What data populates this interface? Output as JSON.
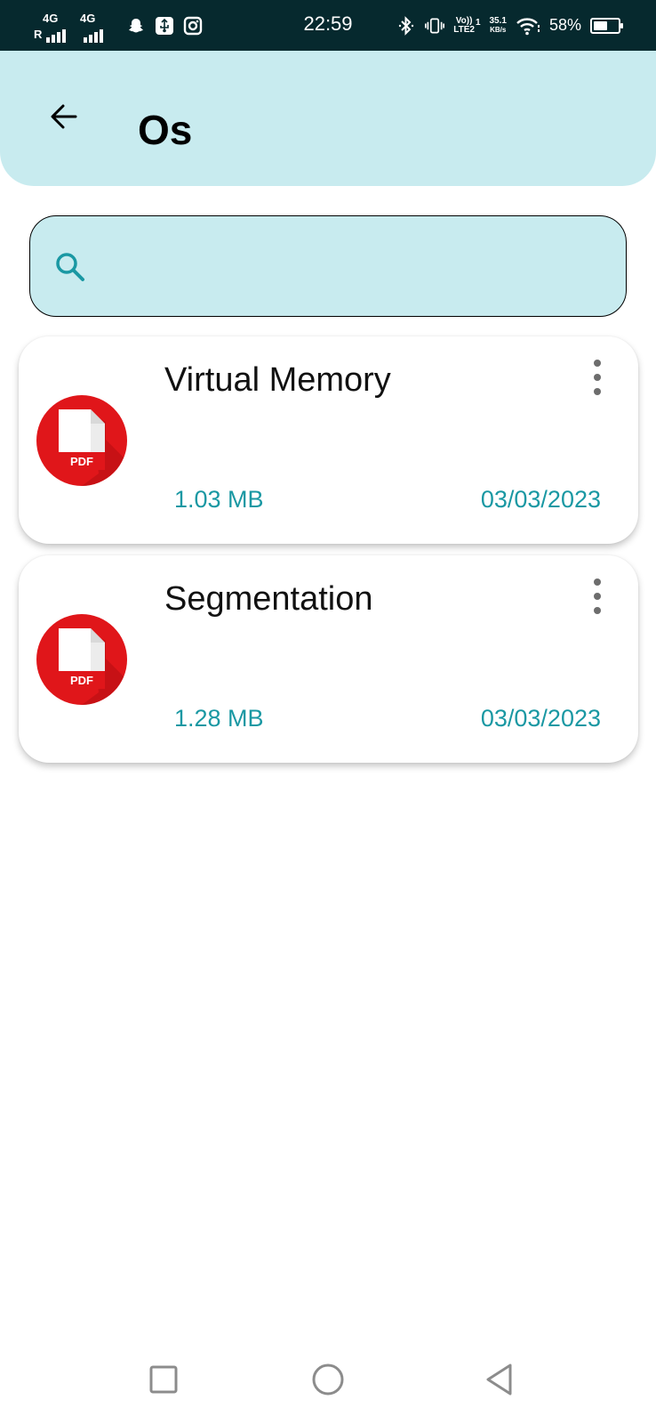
{
  "status_bar": {
    "sim1": {
      "network": "4G",
      "roaming": "R"
    },
    "sim2": {
      "network": "4G"
    },
    "time": "22:59",
    "volte": {
      "line1": "Vo))",
      "line2": "LTE2",
      "sim": "1"
    },
    "net_speed": {
      "value": "35.1",
      "unit": "KB/s"
    },
    "battery_percent": "58%",
    "battery_level": 0.58,
    "icons": [
      "signal-icon",
      "snapchat-icon",
      "usb-debug-icon",
      "instagram-icon",
      "bluetooth-icon",
      "vibrate-icon",
      "wifi-icon",
      "battery-icon"
    ]
  },
  "header": {
    "back_icon": "arrow-back-icon",
    "title": "Os"
  },
  "search": {
    "icon": "search-icon",
    "placeholder": "",
    "value": ""
  },
  "files": [
    {
      "name": "Virtual Memory",
      "size": "1.03 MB",
      "date": "03/03/2023",
      "icon": "pdf-icon",
      "icon_label": "PDF",
      "menu_icon": "more-vert-icon"
    },
    {
      "name": "Segmentation",
      "size": "1.28 MB",
      "date": "03/03/2023",
      "icon": "pdf-icon",
      "icon_label": "PDF",
      "menu_icon": "more-vert-icon"
    }
  ],
  "nav_bar": {
    "buttons": [
      "recents-square-icon",
      "home-circle-icon",
      "back-triangle-icon"
    ]
  },
  "colors": {
    "status_bar_bg": "#06292e",
    "header_bg": "#c8ebef",
    "accent_text": "#1a98a3",
    "pdf_red": "#e0161a"
  }
}
